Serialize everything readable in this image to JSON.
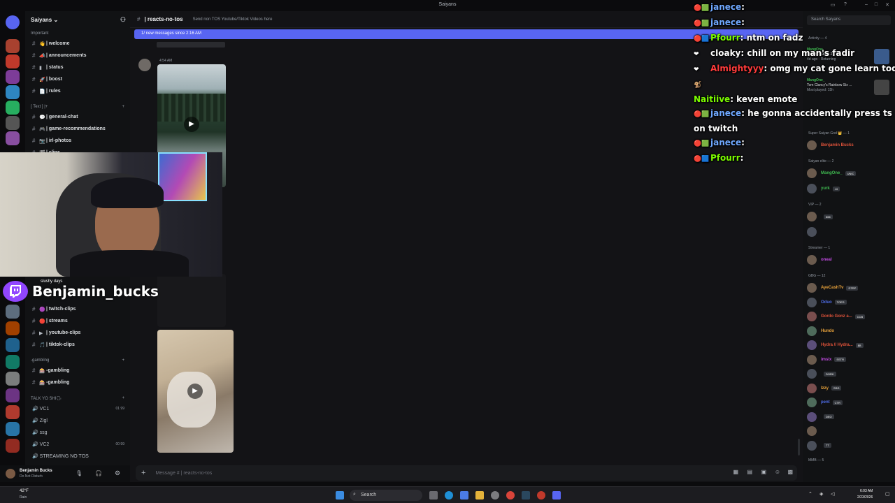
{
  "window": {
    "title": "Saiyans"
  },
  "server": {
    "name": "Saiyans"
  },
  "sidebar": {
    "cat_important": "Important",
    "channels_important": [
      {
        "emoji": "👋",
        "label": "| welcome"
      },
      {
        "emoji": "📣",
        "label": "| announcements"
      },
      {
        "emoji": "▮",
        "label": "| status"
      },
      {
        "emoji": "🚀",
        "label": "| boost"
      },
      {
        "emoji": "📄",
        "label": "| rules"
      }
    ],
    "cat_text": "[ Text ] |+",
    "channels_text": [
      {
        "emoji": "💬",
        "label": "| general-chat"
      },
      {
        "emoji": "🎮",
        "label": "| game-recommendations"
      },
      {
        "emoji": "📷",
        "label": "| irl-photos"
      },
      {
        "emoji": "🎬",
        "label": "| clips"
      }
    ],
    "channels_clips": [
      {
        "emoji": "🟣",
        "label": "| twitch-clips"
      },
      {
        "emoji": "🔴",
        "label": "| streams"
      },
      {
        "emoji": "▶",
        "label": "| youtube-clips"
      },
      {
        "emoji": "🎵",
        "label": "| tiktok-clips"
      }
    ],
    "cat_gambling": "-gambling",
    "channels_gambling": [
      {
        "emoji": "🎰",
        "label": "-gambling"
      },
      {
        "emoji": "🎰",
        "label": "-gambling"
      }
    ],
    "cat_talk": "TALK YO SHI🗣",
    "voice": [
      {
        "label": "VC1",
        "count": "01 99"
      },
      {
        "label": "Zigl",
        "count": ""
      },
      {
        "label": "ssg",
        "count": ""
      },
      {
        "label": "VC2",
        "count": "00 99"
      },
      {
        "label": "STREAMING NO TOS",
        "count": ""
      }
    ],
    "user": {
      "name": "Benjamin Bucks",
      "status": "Do Not Disturb"
    }
  },
  "channel": {
    "name": "| reacts-no-tos",
    "topic": "Send non TOS Youtube/Tiktok Videos here",
    "new_messages": "1/ new messages since 2:16 AM",
    "msg_time": "4:54 AM",
    "composer_placeholder": "Message # | reacts-no-tos"
  },
  "members": {
    "search_placeholder": "Search Saiyans",
    "activity": "Activity — 4",
    "activity_items": [
      {
        "name": "MangOne_",
        "game": "Counter-Strike 2",
        "sub": "4d ago · Returning"
      },
      {
        "name": "MangOne_",
        "game": "Tom Clancy's Rainbow Six ...",
        "sub": "Most played: 15h"
      }
    ],
    "sections": [
      {
        "title": "Super Saiyan God 👑 — 1",
        "members": [
          {
            "name": "Benjamin Bucks",
            "color": "#e0533a",
            "tag": ""
          }
        ]
      },
      {
        "title": "Saiyan elite — 2",
        "members": [
          {
            "name": "MangOne_",
            "color": "#3fb950",
            "tag": "UNIC"
          },
          {
            "name": "yurk",
            "color": "#3fb950",
            "tag": "J4"
          }
        ]
      },
      {
        "title": "VIP — 2",
        "members": [
          {
            "name": "",
            "color": "#e0533a",
            "tag": "666"
          },
          {
            "name": "",
            "color": "#e0533a",
            "tag": ""
          }
        ]
      },
      {
        "title": "Streamer — 1",
        "members": [
          {
            "name": "oneal",
            "color": "#c04be0",
            "tag": ""
          }
        ]
      },
      {
        "title": "GBG — 12",
        "members": [
          {
            "name": "AyeCashTv",
            "color": "#e8a23b",
            "tag": "DTRP"
          },
          {
            "name": "Oduo",
            "color": "#4f6de8",
            "tag": "TOES"
          },
          {
            "name": "Gordo Gonz a...",
            "color": "#e0533a",
            "tag": "CCB"
          },
          {
            "name": "Hundo",
            "color": "#e8a23b",
            "tag": ""
          },
          {
            "name": "Hydra // Hydra...",
            "color": "#e0533a",
            "tag": "$B"
          },
          {
            "name": "imsix",
            "color": "#c04be0",
            "tag": "SSTR"
          },
          {
            "name": "",
            "color": "#4f6de8",
            "tag": "DORK"
          },
          {
            "name": "Izzy",
            "color": "#e8a23b",
            "tag": "SSG"
          },
          {
            "name": "pent",
            "color": "#4f6de8",
            "tag": "CTR"
          },
          {
            "name": "",
            "color": "#e0533a",
            "tag": "DEO"
          },
          {
            "name": "",
            "color": "#dbdee1",
            "tag": ""
          },
          {
            "name": "",
            "color": "#e0533a",
            "tag": "TT"
          }
        ]
      },
      {
        "title": "MMB — 5",
        "members": []
      }
    ]
  },
  "overlay_chat": [
    {
      "user": "janece",
      "color": "#6fa8ff",
      "text": "",
      "badges": "🔴🟩"
    },
    {
      "user": "janece",
      "color": "#6fa8ff",
      "text": "",
      "badges": "🔴🟩"
    },
    {
      "user": "Pfourr",
      "color": "#7cfc00",
      "text": "ntm on fadz",
      "badges": "🔴🟦"
    },
    {
      "user": "cloaky",
      "color": "#ffffff",
      "text": "chill on my man's fadir",
      "badges": "❤"
    },
    {
      "user": "Almightyyy",
      "color": "#ff3b3b",
      "text": "omg my cat gone learn today",
      "badges": "❤"
    },
    {
      "user": "",
      "color": "#ffffff",
      "text": "",
      "badges": "🐒"
    },
    {
      "user": "Naitiive",
      "color": "#7cfc00",
      "text": "keven emote",
      "badges": ""
    },
    {
      "user": "janece",
      "color": "#6fa8ff",
      "text": "he gonna accidentally press ts",
      "badges": "🔴🟩"
    },
    {
      "user": "",
      "color": "#ffffff",
      "text": "on twitch",
      "badges": ""
    },
    {
      "user": "janece",
      "color": "#6fa8ff",
      "text": "",
      "badges": "🔴🟩"
    },
    {
      "user": "Pfourr",
      "color": "#7cfc00",
      "text": "",
      "badges": "🔴🟦"
    }
  ],
  "stream": {
    "channel_name": "Benjamin_bucks",
    "overlay_text": "slushy days"
  },
  "taskbar": {
    "weather_temp": "42°F",
    "weather_label": "Rain",
    "search": "Search",
    "time": "6:03 AM",
    "date": "2/23/2026"
  }
}
